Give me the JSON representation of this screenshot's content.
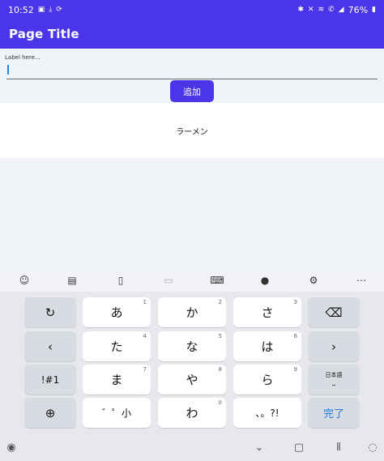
{
  "status_bar": {
    "time": "10:52",
    "battery": "76%",
    "left_icons": [
      "image-icon",
      "download-icon",
      "sync-off-icon"
    ],
    "right_icons": [
      "bluetooth-icon",
      "mute-icon",
      "wifi-icon",
      "call-icon",
      "signal-icon",
      "battery-icon"
    ]
  },
  "app_bar": {
    "title": "Page Title"
  },
  "form": {
    "label": "Label here...",
    "input_value": "",
    "add_button": "追加"
  },
  "list": {
    "items": [
      "ラーメン"
    ]
  },
  "keyboard": {
    "toolbar_icons": [
      "emoji-icon",
      "sticker-icon",
      "clipboard-icon",
      "handwriting-icon",
      "keyboard-layout-icon",
      "microphone-icon",
      "settings-icon",
      "more-icon"
    ],
    "rows": [
      {
        "left": "undo-icon",
        "keys": [
          {
            "label": "あ",
            "hint": "1"
          },
          {
            "label": "か",
            "hint": "2"
          },
          {
            "label": "さ",
            "hint": "3"
          }
        ],
        "right": "backspace-icon"
      },
      {
        "left": "cursor-left-icon",
        "keys": [
          {
            "label": "た",
            "hint": "4"
          },
          {
            "label": "な",
            "hint": "5"
          },
          {
            "label": "は",
            "hint": "6"
          }
        ],
        "right": "cursor-right-icon"
      },
      {
        "left_label": "!#1",
        "keys": [
          {
            "label": "ま",
            "hint": "7"
          },
          {
            "label": "や",
            "hint": "8"
          },
          {
            "label": "ら",
            "hint": "9"
          }
        ],
        "right_label": "日本語",
        "right_sub": "⎵"
      },
      {
        "left": "globe-icon",
        "keys": [
          {
            "label": "゛゜小",
            "hint": ""
          },
          {
            "label": "わ",
            "hint": "0"
          },
          {
            "label": "、。?!",
            "hint": ""
          }
        ],
        "right_label": "完了"
      }
    ]
  },
  "nav_bar": {
    "icons": [
      "keyboard-switch-icon",
      "hide-keyboard-icon",
      "home-icon",
      "recents-icon",
      "accessibility-icon"
    ]
  }
}
